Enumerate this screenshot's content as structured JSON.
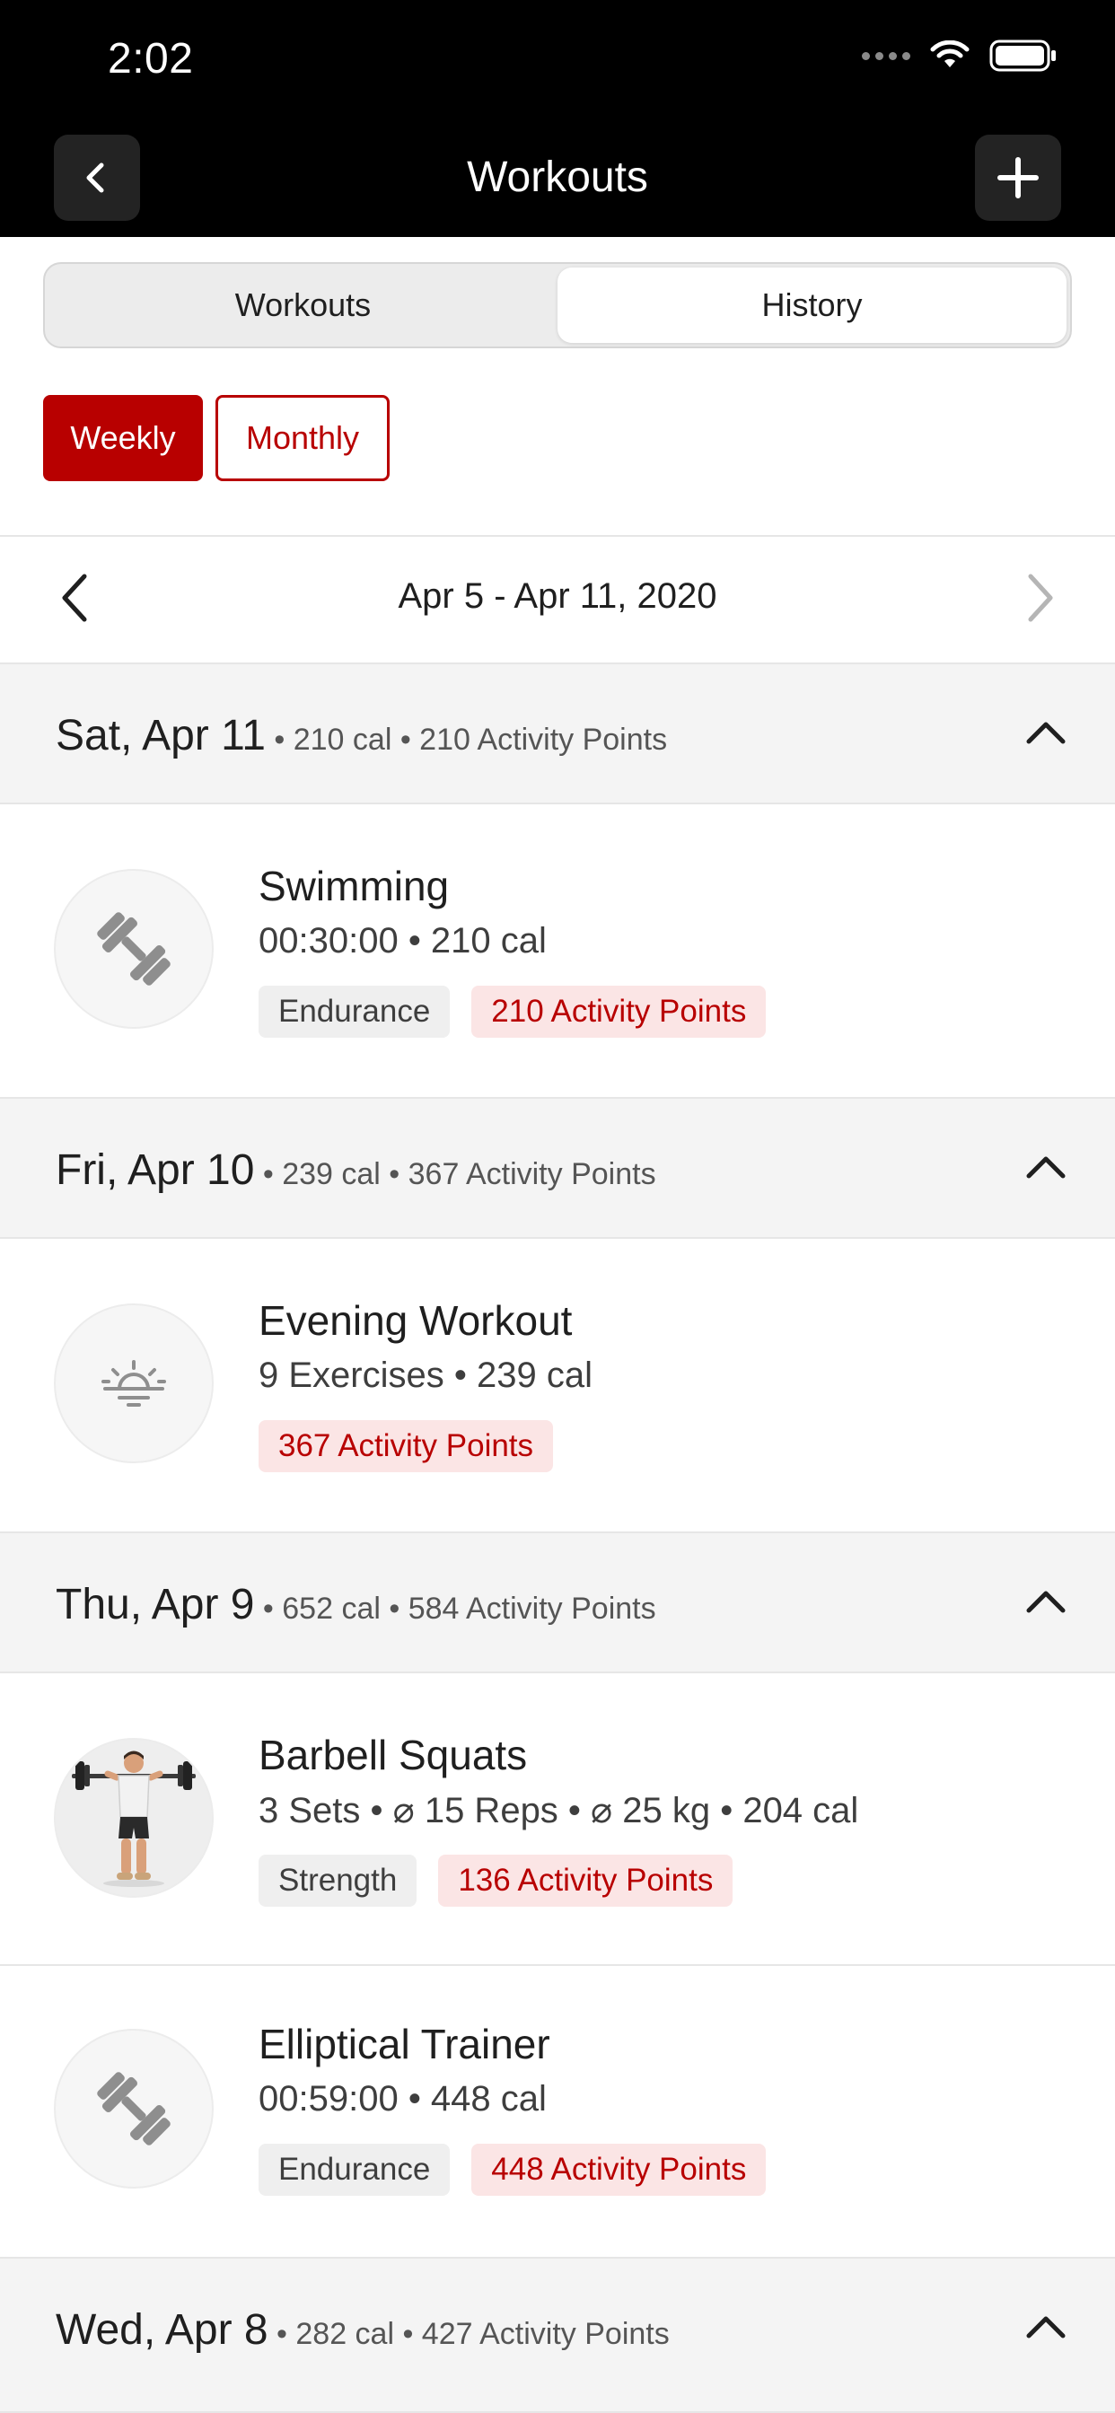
{
  "status_bar": {
    "time": "2:02"
  },
  "nav": {
    "title": "Workouts",
    "back_icon": "chevron-left-icon",
    "add_icon": "plus-icon"
  },
  "segments": {
    "tabs": [
      {
        "label": "Workouts",
        "active": false
      },
      {
        "label": "History",
        "active": true
      }
    ]
  },
  "filters": {
    "weekly": "Weekly",
    "monthly": "Monthly",
    "selected": "Weekly"
  },
  "week_nav": {
    "range": "Apr 5 - Apr 11, 2020"
  },
  "days": [
    {
      "date": "Sat, Apr 11",
      "meta": " • 210 cal • 210 Activity Points",
      "entries": [
        {
          "title": "Swimming",
          "subtitle": "00:30:00 • 210 cal",
          "tag_type": "Endurance",
          "tag_points": "210 Activity Points",
          "icon": "dumbbell-icon"
        }
      ]
    },
    {
      "date": "Fri, Apr 10",
      "meta": " • 239 cal • 367 Activity Points",
      "entries": [
        {
          "title": "Evening Workout",
          "subtitle": "9 Exercises • 239 cal",
          "tag_points": "367 Activity Points",
          "icon": "sunset-icon"
        }
      ]
    },
    {
      "date": "Thu, Apr 9",
      "meta": " • 652 cal • 584 Activity Points",
      "entries": [
        {
          "title": "Barbell Squats",
          "subtitle": "3 Sets • ⌀ 15 Reps • ⌀ 25 kg • 204 cal",
          "tag_type": "Strength",
          "tag_points": "136 Activity Points",
          "icon": "barbell-squat-figure"
        },
        {
          "title": "Elliptical Trainer",
          "subtitle": "00:59:00 • 448 cal",
          "tag_type": "Endurance",
          "tag_points": "448 Activity Points",
          "icon": "dumbbell-icon"
        }
      ]
    },
    {
      "date": "Wed, Apr 8",
      "meta": " • 282 cal • 427 Activity Points",
      "entries": []
    }
  ],
  "colors": {
    "accent": "#b80000",
    "accent_light": "#fbe5e5",
    "header_bg": "#000000",
    "section_bg": "#f4f4f4"
  }
}
